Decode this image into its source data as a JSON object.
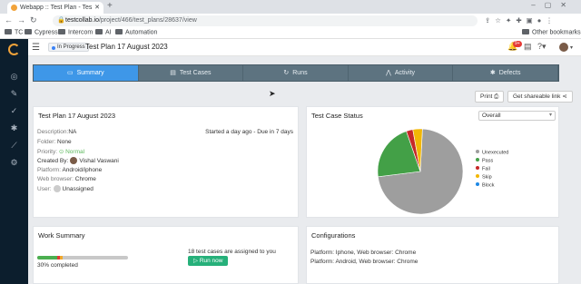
{
  "browser": {
    "tab_title": "Webapp :: Test Plan - Tes",
    "url_host": "testcollab.io",
    "url_path": "/project/466/test_plans/28637/view",
    "bookmarks": [
      "TC",
      "Cypress",
      "Intercom",
      "AI",
      "Automation"
    ],
    "other_bookmarks": "Other bookmarks"
  },
  "header": {
    "status": "In Progress",
    "title": "Test Plan 17 August 2023",
    "notif_badge": "9+"
  },
  "tabs": [
    {
      "label": "Summary",
      "icon": "doc-icon",
      "active": true
    },
    {
      "label": "Test Cases",
      "icon": "list-icon",
      "active": false
    },
    {
      "label": "Runs",
      "icon": "refresh-icon",
      "active": false
    },
    {
      "label": "Activity",
      "icon": "activity-icon",
      "active": false
    },
    {
      "label": "Defects",
      "icon": "bug-icon",
      "active": false
    }
  ],
  "actions": {
    "print": "Print",
    "share": "Get shareable link"
  },
  "plan": {
    "title": "Test Plan 17 August 2023",
    "started": "Started a day ago - Due in 7 days",
    "description_label": "Description:",
    "description": "NA",
    "folder_label": "Folder:",
    "folder": "None",
    "priority_label": "Priority:",
    "priority": "Normal",
    "created_label": "Created By:",
    "created_by": "Vishal Vaswani",
    "platform_label": "Platform:",
    "platform": "Android/iphone",
    "browser_label": "Web browser:",
    "browser": "Chrome",
    "user_label": "User:",
    "user": "Unassigned"
  },
  "status_card": {
    "title": "Test Case Status",
    "filter": "Overall"
  },
  "chart_data": {
    "type": "pie",
    "title": "",
    "categories": [
      "Unexecuted",
      "Pass",
      "Fail",
      "Skip",
      "Block"
    ],
    "values": [
      13,
      3.9,
      0.45,
      0.65,
      0
    ],
    "colors": [
      "#9e9e9e",
      "#43a047",
      "#c62828",
      "#f2b705",
      "#1e88e5"
    ]
  },
  "work": {
    "title": "Work Summary",
    "completed_text": "30% completed",
    "progress": {
      "pass": 0.22,
      "fail": 0.025,
      "skip": 0.035
    },
    "assigned_text": "18 test cases are assigned to you",
    "run_button": "Run now"
  },
  "configurations": {
    "title": "Configurations",
    "items": [
      "Platform: Iphone, Web browser: Chrome",
      "Platform: Android, Web browser: Chrome"
    ]
  }
}
